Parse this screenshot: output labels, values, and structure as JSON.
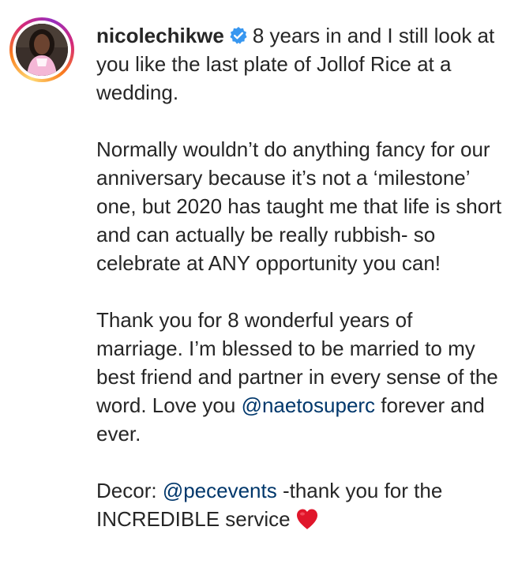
{
  "post": {
    "username": "nicolechikwe",
    "verified": true,
    "paragraphs": [
      {
        "text": "8 years in and I still look at you like the last plate of Jollof Rice at a wedding."
      },
      {
        "text": "Normally wouldn’t do anything fancy for our anniversary because it’s not a ‘milestone’ one, but 2020 has taught me that life is short and can actually be really rubbish- so celebrate at ANY opportunity you can!"
      },
      {
        "text_before": "Thank you for 8 wonderful years of marriage. I’m blessed to be married to my best friend and partner in every sense of the word. Love you ",
        "mention": "@naetosuperc",
        "text_after": " forever and ever."
      },
      {
        "text_before": "Decor: ",
        "mention": "@pecevents",
        "text_after": " -thank you for the INCREDIBLE service",
        "emoji": "red-heart"
      }
    ]
  },
  "colors": {
    "text": "#262626",
    "mention": "#00376b",
    "verified_badge": "#3897f0",
    "heart": "#e0162b"
  }
}
